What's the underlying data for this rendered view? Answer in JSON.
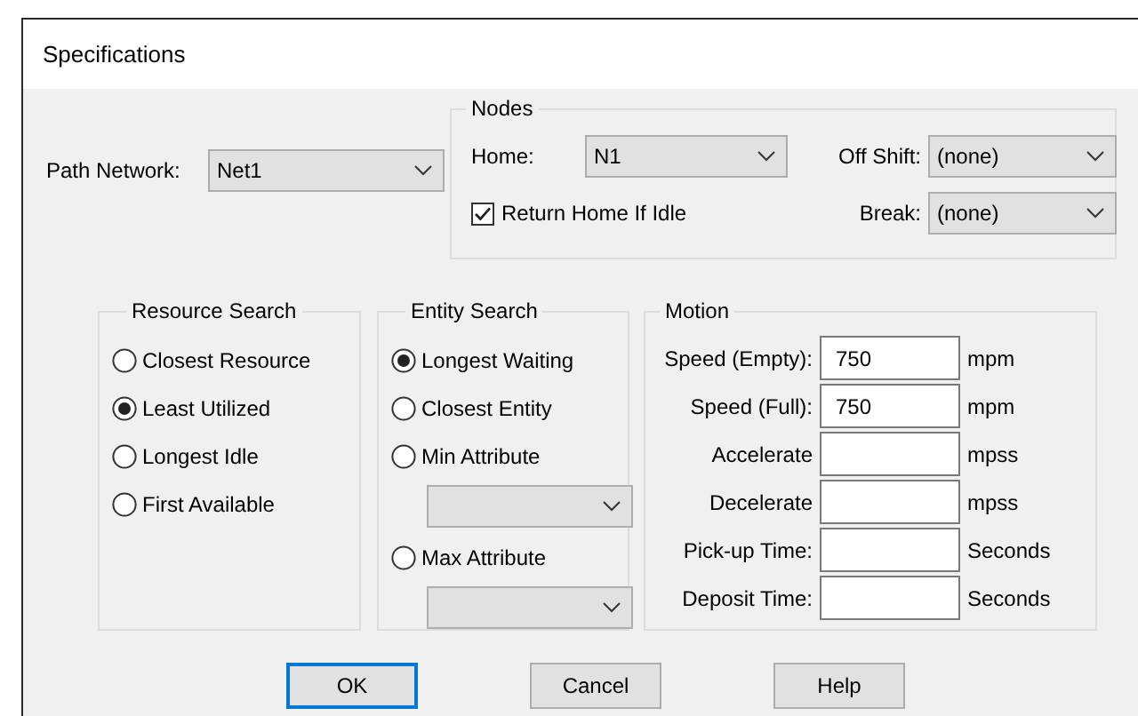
{
  "window": {
    "title": "Specifications"
  },
  "path_network": {
    "label": "Path Network:",
    "value": "Net1"
  },
  "nodes": {
    "legend": "Nodes",
    "home": {
      "label": "Home:",
      "value": "N1"
    },
    "off_shift": {
      "label": "Off Shift:",
      "value": "(none)"
    },
    "return_home": {
      "label": "Return Home If Idle",
      "checked": true
    },
    "break": {
      "label": "Break:",
      "value": "(none)"
    }
  },
  "resource_search": {
    "legend": "Resource Search",
    "options": [
      {
        "label": "Closest Resource",
        "selected": false
      },
      {
        "label": "Least Utilized",
        "selected": true
      },
      {
        "label": "Longest Idle",
        "selected": false
      },
      {
        "label": "First Available",
        "selected": false
      }
    ]
  },
  "entity_search": {
    "legend": "Entity Search",
    "options": [
      {
        "label": "Longest Waiting",
        "selected": true,
        "kind": "plain"
      },
      {
        "label": "Closest Entity",
        "selected": false,
        "kind": "plain"
      },
      {
        "label": "Min Attribute",
        "selected": false,
        "kind": "attribute"
      },
      {
        "label": "Max Attribute",
        "selected": false,
        "kind": "attribute"
      }
    ]
  },
  "motion": {
    "legend": "Motion",
    "rows": [
      {
        "label": "Speed (Empty):",
        "value": "750",
        "unit": "mpm"
      },
      {
        "label": "Speed (Full):",
        "value": "750",
        "unit": "mpm"
      },
      {
        "label": "Accelerate",
        "unit": "mpss"
      },
      {
        "label": "Decelerate",
        "unit": "mpss"
      },
      {
        "label": "Pick-up Time:",
        "unit": "Seconds"
      },
      {
        "label": "Deposit Time:",
        "unit": "Seconds"
      }
    ]
  },
  "buttons": [
    {
      "label": "OK",
      "focused": true
    },
    {
      "label": "Cancel",
      "focused": false
    },
    {
      "label": "Help",
      "focused": false
    }
  ]
}
